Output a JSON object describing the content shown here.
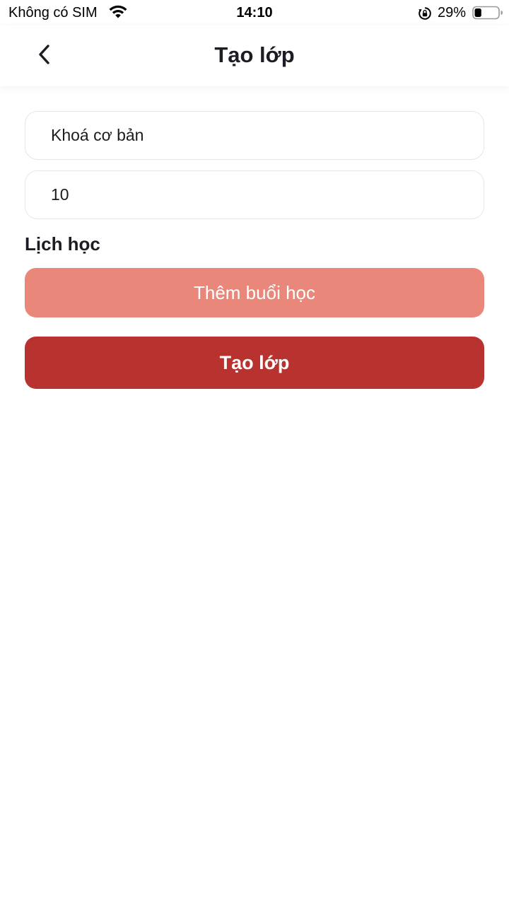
{
  "status_bar": {
    "carrier": "Không có SIM",
    "time": "14:10",
    "battery_percent": "29%",
    "wifi_icon": "wifi-icon",
    "rotation_lock_icon": "rotation-lock-icon",
    "battery_icon": "battery-icon",
    "battery_level": 0.29
  },
  "header": {
    "title": "Tạo lớp",
    "back_icon": "chevron-left-icon"
  },
  "form": {
    "course_name": {
      "value": "Khoá cơ bản"
    },
    "session_count": {
      "value": "10"
    },
    "schedule_label": "Lịch học",
    "add_session_label": "Thêm buổi học",
    "create_class_label": "Tạo lớp"
  },
  "colors": {
    "add_session_button": "#e9887a",
    "create_class_button": "#b83330",
    "field_border": "#e6e6ea"
  }
}
